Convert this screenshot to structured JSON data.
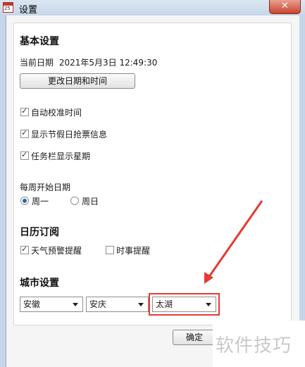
{
  "window": {
    "title": "设置",
    "icon_text": "25",
    "close_label": "✕"
  },
  "basic": {
    "heading": "基本设置",
    "current_date_label": "当前日期",
    "current_date_value": "2021年5月3日 12:49:30",
    "change_button": "更改日期和时间",
    "checkboxes": [
      {
        "label": "自动校准时间",
        "checked": true
      },
      {
        "label": "显示节假日抢票信息",
        "checked": true
      },
      {
        "label": "任务栏显示星期",
        "checked": true
      }
    ],
    "week_start_label": "每周开始日期",
    "week_start_options": [
      {
        "label": "周一",
        "selected": true
      },
      {
        "label": "周日",
        "selected": false
      }
    ]
  },
  "calendar": {
    "heading": "日历订阅",
    "options": [
      {
        "label": "天气预警提醒",
        "checked": true
      },
      {
        "label": "时事提醒",
        "checked": false
      }
    ]
  },
  "city": {
    "heading": "城市设置",
    "province": "安徽",
    "city": "安庆",
    "county": "太湖"
  },
  "footer": {
    "ok_button": "确定"
  },
  "watermark": "软件技巧",
  "colors": {
    "highlight": "#e23b32",
    "arrow": "#e23b32"
  }
}
